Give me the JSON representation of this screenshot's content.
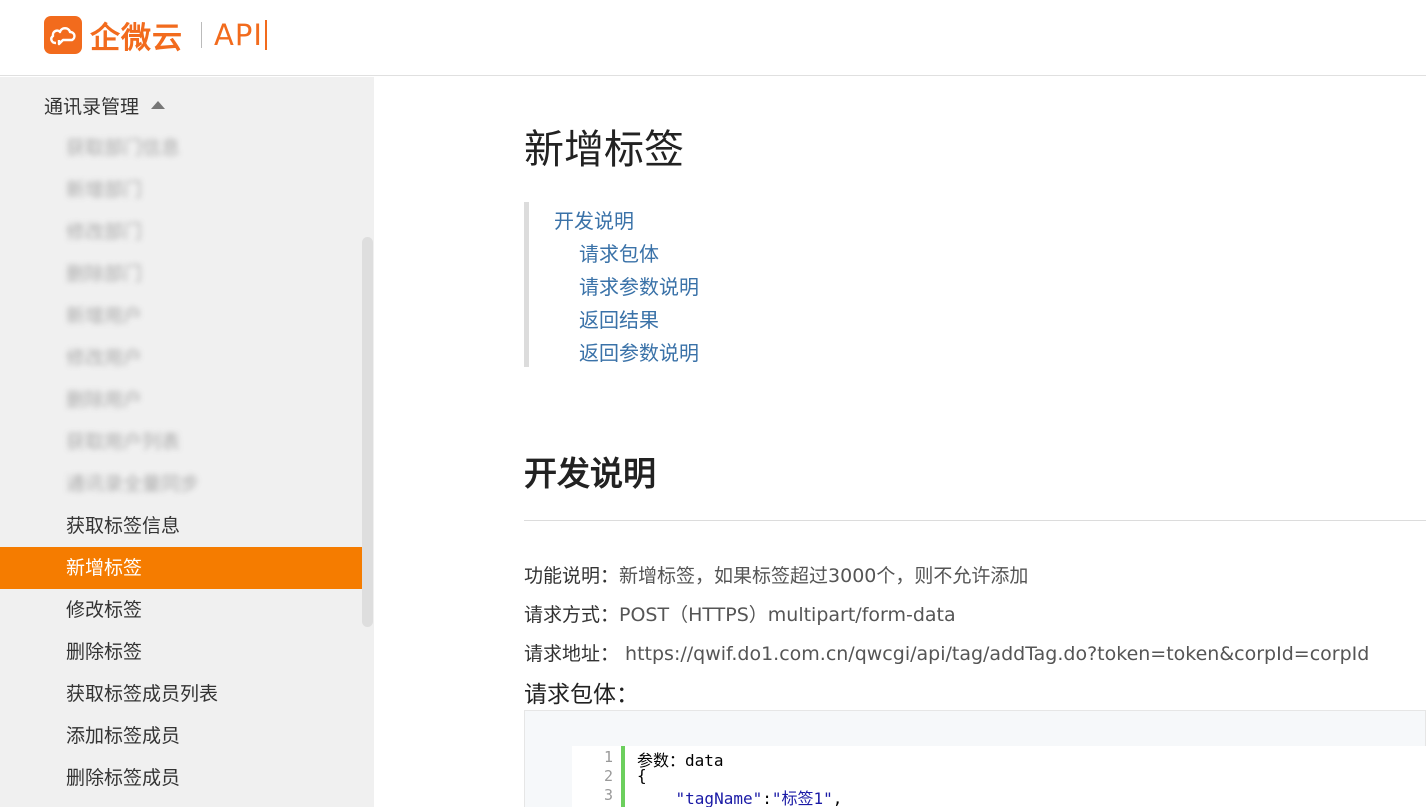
{
  "header": {
    "brand": "企微云",
    "api_label": "API"
  },
  "sidebar": {
    "group_label": "通讯录管理",
    "items": [
      {
        "label": "获取部门信息",
        "blurred": true
      },
      {
        "label": "新增部门",
        "blurred": true
      },
      {
        "label": "修改部门",
        "blurred": true
      },
      {
        "label": "删除部门",
        "blurred": true
      },
      {
        "label": "新增用户",
        "blurred": true
      },
      {
        "label": "修改用户",
        "blurred": true
      },
      {
        "label": "删除用户",
        "blurred": true
      },
      {
        "label": "获取用户列表",
        "blurred": true
      },
      {
        "label": "通讯录全量同步",
        "blurred": true
      },
      {
        "label": "获取标签信息",
        "blurred": false
      },
      {
        "label": "新增标签",
        "blurred": false,
        "active": true
      },
      {
        "label": "修改标签",
        "blurred": false
      },
      {
        "label": "删除标签",
        "blurred": false
      },
      {
        "label": "获取标签成员列表",
        "blurred": false
      },
      {
        "label": "添加标签成员",
        "blurred": false
      },
      {
        "label": "删除标签成员",
        "blurred": false
      }
    ]
  },
  "main": {
    "title": "新增标签",
    "toc": {
      "root": "开发说明",
      "children": [
        "请求包体",
        "请求参数说明",
        "返回结果",
        "返回参数说明"
      ]
    },
    "section_title": "开发说明",
    "info": {
      "func_label": "功能说明：",
      "func_value": "新增标签，如果标签超过3000个，则不允许添加",
      "method_label": "请求方式：",
      "method_value": "POST（HTTPS）multipart/form-data",
      "url_label": "请求地址：",
      "url_value": " https://qwif.do1.com.cn/qwcgi/api/tag/addTag.do?token=token&corpId=corpId"
    },
    "body_title": "请求包体：",
    "code": {
      "line_numbers": [
        "1",
        "2",
        "3"
      ],
      "line1": "参数：data",
      "line2": "{",
      "line3_indent": "    ",
      "line3_key": "\"tagName\"",
      "line3_colon": ":",
      "line3_value": "\"标签1\"",
      "line3_comma": ","
    }
  },
  "colors": {
    "brand_orange": "#f26b1d",
    "active_bg": "#f57c00",
    "link_blue": "#3a72a8",
    "gutter_green": "#6ccf5d"
  }
}
